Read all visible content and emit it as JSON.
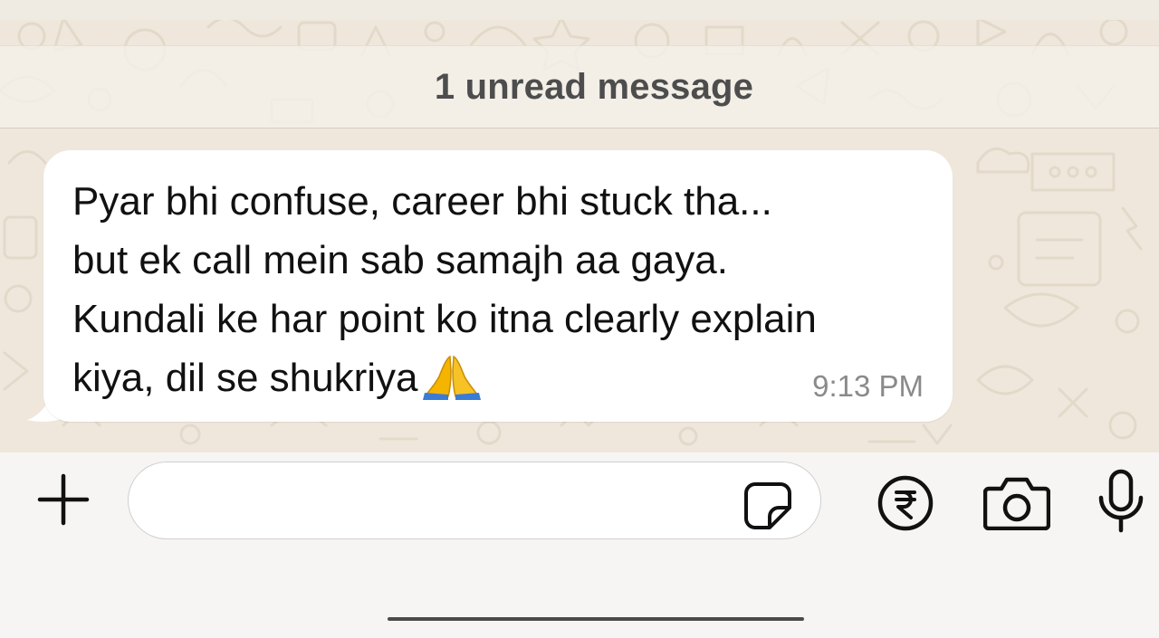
{
  "banner": {
    "unread_text": "1 unread message"
  },
  "message": {
    "lines": [
      "Pyar bhi confuse, career bhi stuck tha...",
      "but ek call mein sab samajh aa gaya.",
      "Kundali ke har point ko itna clearly explain",
      "kiya, dil se shukriya"
    ],
    "emoji": "folded-hands",
    "time": "9:13 PM"
  },
  "composer": {
    "placeholder": "",
    "value": ""
  },
  "icons": {
    "add": "plus-icon",
    "sticker": "sticker-icon",
    "payment": "rupee-icon",
    "camera": "camera-icon",
    "mic": "microphone-icon"
  },
  "colors": {
    "wallpaper": "#efe7dc",
    "bubble": "#ffffff",
    "text": "#111111",
    "timestamp": "#8a8a8a",
    "banner_text": "#4d4d4d"
  }
}
